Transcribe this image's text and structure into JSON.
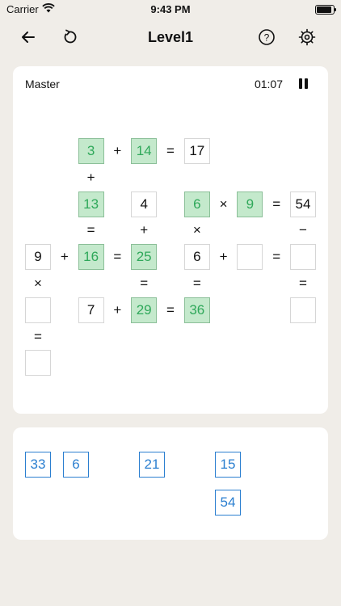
{
  "status_bar": {
    "carrier": "Carrier",
    "time": "9:43 PM",
    "battery_level": 0.9
  },
  "nav": {
    "title": "Level1",
    "icons": [
      "back-arrow-icon",
      "restart-icon",
      "help-icon",
      "settings-gear-icon"
    ]
  },
  "game": {
    "difficulty": "Master",
    "timer": "01:07",
    "cells": [
      {
        "name": "cell-3",
        "type": "filled",
        "text": "3",
        "pos": [
          2,
          0
        ]
      },
      {
        "name": "op-plus",
        "type": "op",
        "text": "+",
        "pos": [
          3,
          0
        ]
      },
      {
        "name": "cell-14",
        "type": "filled",
        "text": "14",
        "pos": [
          4,
          0
        ]
      },
      {
        "name": "op-equals",
        "type": "op",
        "text": "=",
        "pos": [
          5,
          0
        ]
      },
      {
        "name": "cell-17",
        "type": "given",
        "text": "17",
        "pos": [
          6,
          0
        ]
      },
      {
        "name": "op-plus",
        "type": "op",
        "text": "+",
        "pos": [
          2,
          1
        ]
      },
      {
        "name": "cell-13",
        "type": "filled",
        "text": "13",
        "pos": [
          2,
          2
        ]
      },
      {
        "name": "cell-4",
        "type": "given",
        "text": "4",
        "pos": [
          4,
          2
        ]
      },
      {
        "name": "cell-6",
        "type": "filled",
        "text": "6",
        "pos": [
          6,
          2
        ]
      },
      {
        "name": "op-times",
        "type": "op",
        "text": "×",
        "pos": [
          7,
          2
        ]
      },
      {
        "name": "cell-9",
        "type": "filled",
        "text": "9",
        "pos": [
          8,
          2
        ]
      },
      {
        "name": "op-equals",
        "type": "op",
        "text": "=",
        "pos": [
          9,
          2
        ]
      },
      {
        "name": "cell-54",
        "type": "given",
        "text": "54",
        "pos": [
          10,
          2
        ]
      },
      {
        "name": "op-equals",
        "type": "op",
        "text": "=",
        "pos": [
          2,
          3
        ]
      },
      {
        "name": "op-plus",
        "type": "op",
        "text": "+",
        "pos": [
          4,
          3
        ]
      },
      {
        "name": "op-times",
        "type": "op",
        "text": "×",
        "pos": [
          6,
          3
        ]
      },
      {
        "name": "op-minus",
        "type": "op",
        "text": "−",
        "pos": [
          10,
          3
        ]
      },
      {
        "name": "cell-9",
        "type": "given",
        "text": "9",
        "pos": [
          0,
          4
        ]
      },
      {
        "name": "op-plus",
        "type": "op",
        "text": "+",
        "pos": [
          1,
          4
        ]
      },
      {
        "name": "cell-16",
        "type": "filled",
        "text": "16",
        "pos": [
          2,
          4
        ]
      },
      {
        "name": "op-equals",
        "type": "op",
        "text": "=",
        "pos": [
          3,
          4
        ]
      },
      {
        "name": "cell-25",
        "type": "filled",
        "text": "25",
        "pos": [
          4,
          4
        ]
      },
      {
        "name": "cell-6",
        "type": "given",
        "text": "6",
        "pos": [
          6,
          4
        ]
      },
      {
        "name": "op-plus",
        "type": "op",
        "text": "+",
        "pos": [
          7,
          4
        ]
      },
      {
        "name": "empty-cell",
        "type": "empty",
        "text": "",
        "pos": [
          8,
          4
        ]
      },
      {
        "name": "op-equals",
        "type": "op",
        "text": "=",
        "pos": [
          9,
          4
        ]
      },
      {
        "name": "empty-cell",
        "type": "empty",
        "text": "",
        "pos": [
          10,
          4
        ]
      },
      {
        "name": "op-times",
        "type": "op",
        "text": "×",
        "pos": [
          0,
          5
        ]
      },
      {
        "name": "op-equals",
        "type": "op",
        "text": "=",
        "pos": [
          4,
          5
        ]
      },
      {
        "name": "op-equals",
        "type": "op",
        "text": "=",
        "pos": [
          6,
          5
        ]
      },
      {
        "name": "op-equals",
        "type": "op",
        "text": "=",
        "pos": [
          10,
          5
        ]
      },
      {
        "name": "empty-cell",
        "type": "empty",
        "text": "",
        "pos": [
          0,
          6
        ]
      },
      {
        "name": "cell-7",
        "type": "given",
        "text": "7",
        "pos": [
          2,
          6
        ]
      },
      {
        "name": "op-plus",
        "type": "op",
        "text": "+",
        "pos": [
          3,
          6
        ]
      },
      {
        "name": "cell-29",
        "type": "filled",
        "text": "29",
        "pos": [
          4,
          6
        ]
      },
      {
        "name": "op-equals",
        "type": "op",
        "text": "=",
        "pos": [
          5,
          6
        ]
      },
      {
        "name": "cell-36",
        "type": "filled",
        "text": "36",
        "pos": [
          6,
          6
        ]
      },
      {
        "name": "empty-cell",
        "type": "empty",
        "text": "",
        "pos": [
          10,
          6
        ]
      },
      {
        "name": "op-equals",
        "type": "op",
        "text": "=",
        "pos": [
          0,
          7
        ]
      },
      {
        "name": "empty-cell",
        "type": "empty",
        "text": "",
        "pos": [
          0,
          8
        ]
      }
    ]
  },
  "tray": {
    "tiles": [
      {
        "value": "33",
        "slot": [
          0,
          0
        ]
      },
      {
        "value": "6",
        "slot": [
          1,
          0
        ]
      },
      {
        "value": "21",
        "slot": [
          3,
          0
        ]
      },
      {
        "value": "15",
        "slot": [
          5,
          0
        ]
      },
      {
        "value": "54",
        "slot": [
          5,
          1
        ]
      }
    ]
  }
}
